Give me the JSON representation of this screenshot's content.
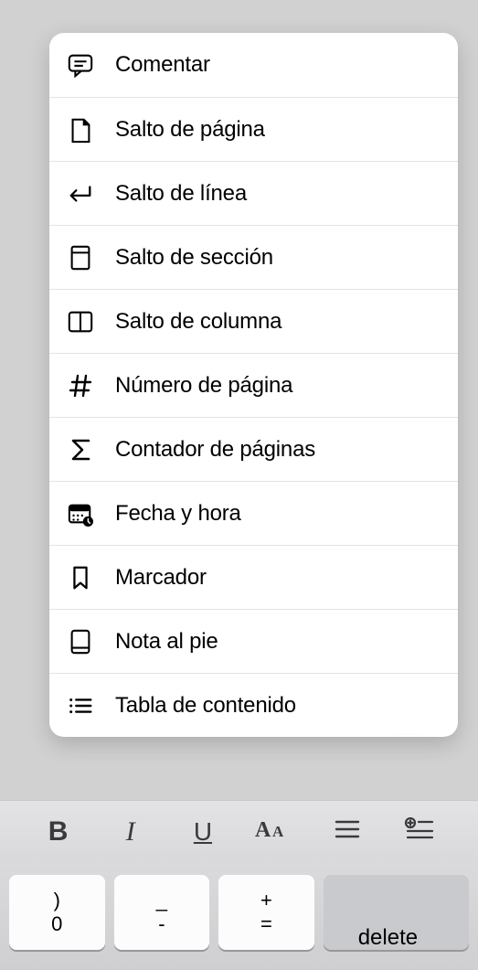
{
  "menu": {
    "items": [
      {
        "id": "comment",
        "icon": "comment-icon",
        "label": "Comentar"
      },
      {
        "id": "page-break",
        "icon": "page-break-icon",
        "label": "Salto de página"
      },
      {
        "id": "line-break",
        "icon": "line-break-icon",
        "label": "Salto de línea"
      },
      {
        "id": "section-break",
        "icon": "section-break-icon",
        "label": "Salto de sección"
      },
      {
        "id": "column-break",
        "icon": "column-break-icon",
        "label": "Salto de columna"
      },
      {
        "id": "page-number",
        "icon": "hash-icon",
        "label": "Número de página"
      },
      {
        "id": "page-count",
        "icon": "sigma-icon",
        "label": "Contador de páginas"
      },
      {
        "id": "date-time",
        "icon": "calendar-icon",
        "label": "Fecha y hora"
      },
      {
        "id": "bookmark",
        "icon": "bookmark-icon",
        "label": "Marcador"
      },
      {
        "id": "footnote",
        "icon": "footnote-icon",
        "label": "Nota al pie"
      },
      {
        "id": "toc",
        "icon": "toc-icon",
        "label": "Tabla de contenido"
      }
    ]
  },
  "toolbar": {
    "bold": "B",
    "italic": "I",
    "underline": "U",
    "style": "AA",
    "align": "≡",
    "insert": "+≡"
  },
  "keyboard": {
    "key0_top": ")",
    "key0_bot": "0",
    "key1_top": "_",
    "key1_bot": "-",
    "key2_top": "+",
    "key2_bot": "=",
    "delete": "delete"
  },
  "colors": {
    "background": "#d1d1d1",
    "popup_bg": "#ffffff",
    "divider": "#e4e4e4",
    "key_bg": "#fcfcfc",
    "delete_bg": "#c9cacd"
  }
}
